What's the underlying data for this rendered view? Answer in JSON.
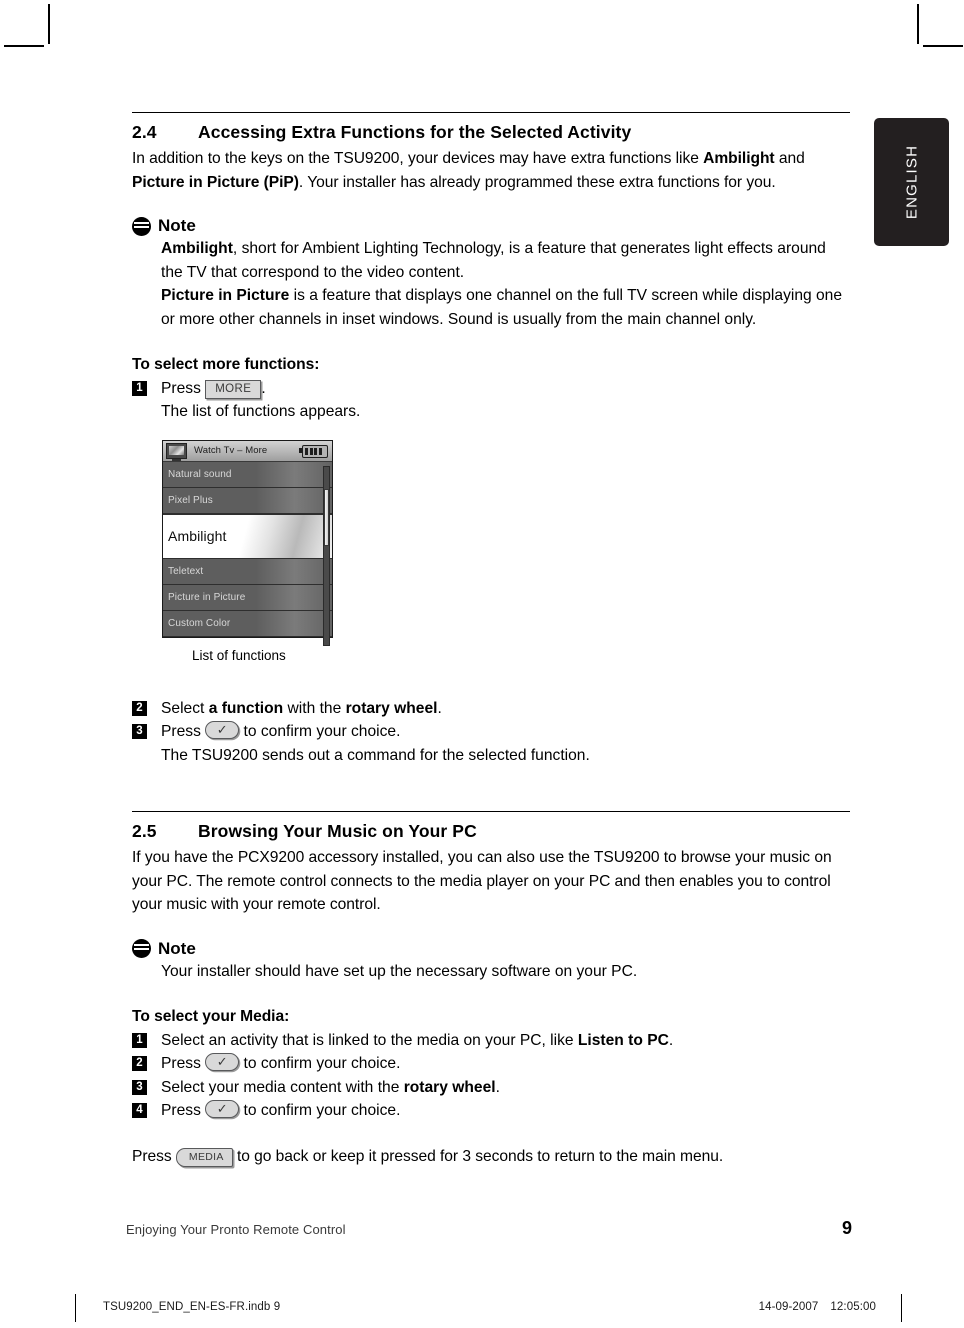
{
  "language_tab": {
    "label": "ENGLISH"
  },
  "sections": {
    "s24": {
      "number": "2.4",
      "title": "Accessing Extra Functions for the Selected Activity",
      "intro_1": "In addition to the keys on the TSU9200, your devices may have extra functions like ",
      "intro_bold_1": "Ambilight",
      "intro_2": " and ",
      "intro_bold_2": "Picture in Picture (PiP)",
      "intro_3": ". Your installer has already programmed these extra functions for you.",
      "note": {
        "title": "Note",
        "line1_bold": "Ambilight",
        "line1_rest": ", short for Ambient Lighting Technology, is a feature that generates light effects around the TV that correspond to the video content.",
        "line2_bold": "Picture in Picture",
        "line2_rest": " is a feature that displays one channel on the full TV screen while displaying one or more other channels in inset windows. Sound is usually  from the main channel only."
      },
      "steps_title": "To select more functions:",
      "step1_pre": "Press ",
      "step1_key": "MORE",
      "step1_post": ".",
      "step1_sub": "The list of functions appears.",
      "figure_caption": "List of functions",
      "step2_pre": "Select ",
      "step2_bold1": "a function",
      "step2_mid": " with the ",
      "step2_bold2": "rotary wheel",
      "step2_post": ".",
      "step3_pre": "Press ",
      "step3_post": " to confirm your choice.",
      "step3_sub": "The TSU9200 sends out a command for the selected function."
    },
    "s25": {
      "number": "2.5",
      "title": "Browsing Your Music on Your PC",
      "intro": "If you have the PCX9200 accessory installed, you can also use the TSU9200 to browse your music on your PC. The remote control connects to the media player on your PC and then enables you to control your music with your remote control.",
      "note": {
        "title": "Note",
        "line1": "Your installer should have set up the necessary software on your PC."
      },
      "steps_title": "To select your Media:",
      "step1_pre": "Select an activity that is linked to the media on your PC, like ",
      "step1_bold": "Listen to PC",
      "step1_post": ".",
      "step2_pre": "Press ",
      "step2_post": " to confirm your choice.",
      "step3_pre": "Select your media content with the ",
      "step3_bold": "rotary wheel",
      "step3_post": ".",
      "step4_pre": "Press ",
      "step4_post": " to confirm your choice.",
      "closing_pre": "Press ",
      "closing_key": "MEDIA",
      "closing_post": " to go back or keep it pressed for 3 seconds to return to the main menu."
    }
  },
  "device_screen": {
    "title": "Watch Tv – More",
    "battery_bars": 4,
    "items": [
      {
        "label": "Natural sound",
        "selected": false
      },
      {
        "label": "Pixel Plus",
        "selected": false
      },
      {
        "label": "Ambilight",
        "selected": true
      },
      {
        "label": "Teletext",
        "selected": false
      },
      {
        "label": "Picture in Picture",
        "selected": false
      },
      {
        "label": "Custom Color",
        "selected": false
      }
    ]
  },
  "step_numbers": {
    "n1": "1",
    "n2": "2",
    "n3": "3",
    "n4": "4"
  },
  "keys": {
    "check_glyph": "✓"
  },
  "footer": {
    "left": "Enjoying Your Pronto Remote Control",
    "page": "9"
  },
  "printbar": {
    "file": "TSU9200_END_EN-ES-FR.indb   9",
    "date": "14-09-2007",
    "time": "12:05:00"
  }
}
